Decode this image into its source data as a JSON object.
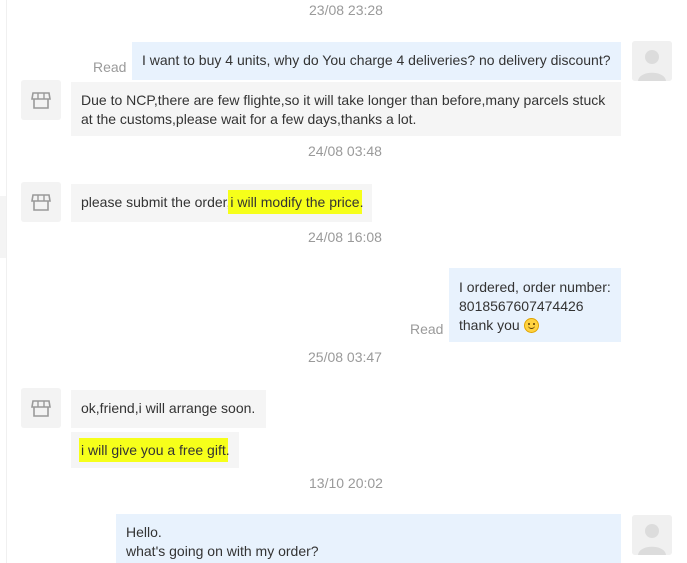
{
  "conversation": {
    "messages": [
      {
        "type": "timestamp",
        "text": "23/08 23:28"
      },
      {
        "type": "outgoing",
        "status": "Read",
        "lines": [
          "I want to buy 4 units, why do You charge 4 deliveries? no delivery discount?"
        ]
      },
      {
        "type": "incoming",
        "lines": [
          "Due to NCP,there are few flighte,so it will take longer than before,many parcels stuck",
          "at the customs,please wait for a few days,thanks a lot."
        ]
      },
      {
        "type": "timestamp",
        "text": "24/08 03:48"
      },
      {
        "type": "incoming",
        "text_plain": "please submit the order,",
        "text_highlight": "i will modify the price",
        "text_tail": "."
      },
      {
        "type": "timestamp",
        "text": "24/08 16:08"
      },
      {
        "type": "outgoing",
        "status": "Read",
        "lines": [
          "I ordered, order number:",
          "8018567607474426",
          "thank you"
        ],
        "emoji": "smiling-face-icon"
      },
      {
        "type": "timestamp",
        "text": "25/08 03:47"
      },
      {
        "type": "incoming",
        "lines": [
          "ok,friend,i will arrange soon."
        ]
      },
      {
        "type": "incoming",
        "text_highlight": "i will give you a free gift",
        "text_tail": "."
      },
      {
        "type": "timestamp",
        "text": "13/10 20:02"
      },
      {
        "type": "outgoing",
        "lines": [
          "Hello.",
          "what's going on with my order?"
        ]
      }
    ]
  },
  "avatars": {
    "seller_icon": "store-icon",
    "buyer_icon": "user-avatar-icon"
  },
  "colors": {
    "outgoing_bubble": "#e8f2fd",
    "incoming_bubble": "#f5f5f5",
    "timestamp_text": "#9a9a9a",
    "highlight": "#f6ff1a"
  }
}
